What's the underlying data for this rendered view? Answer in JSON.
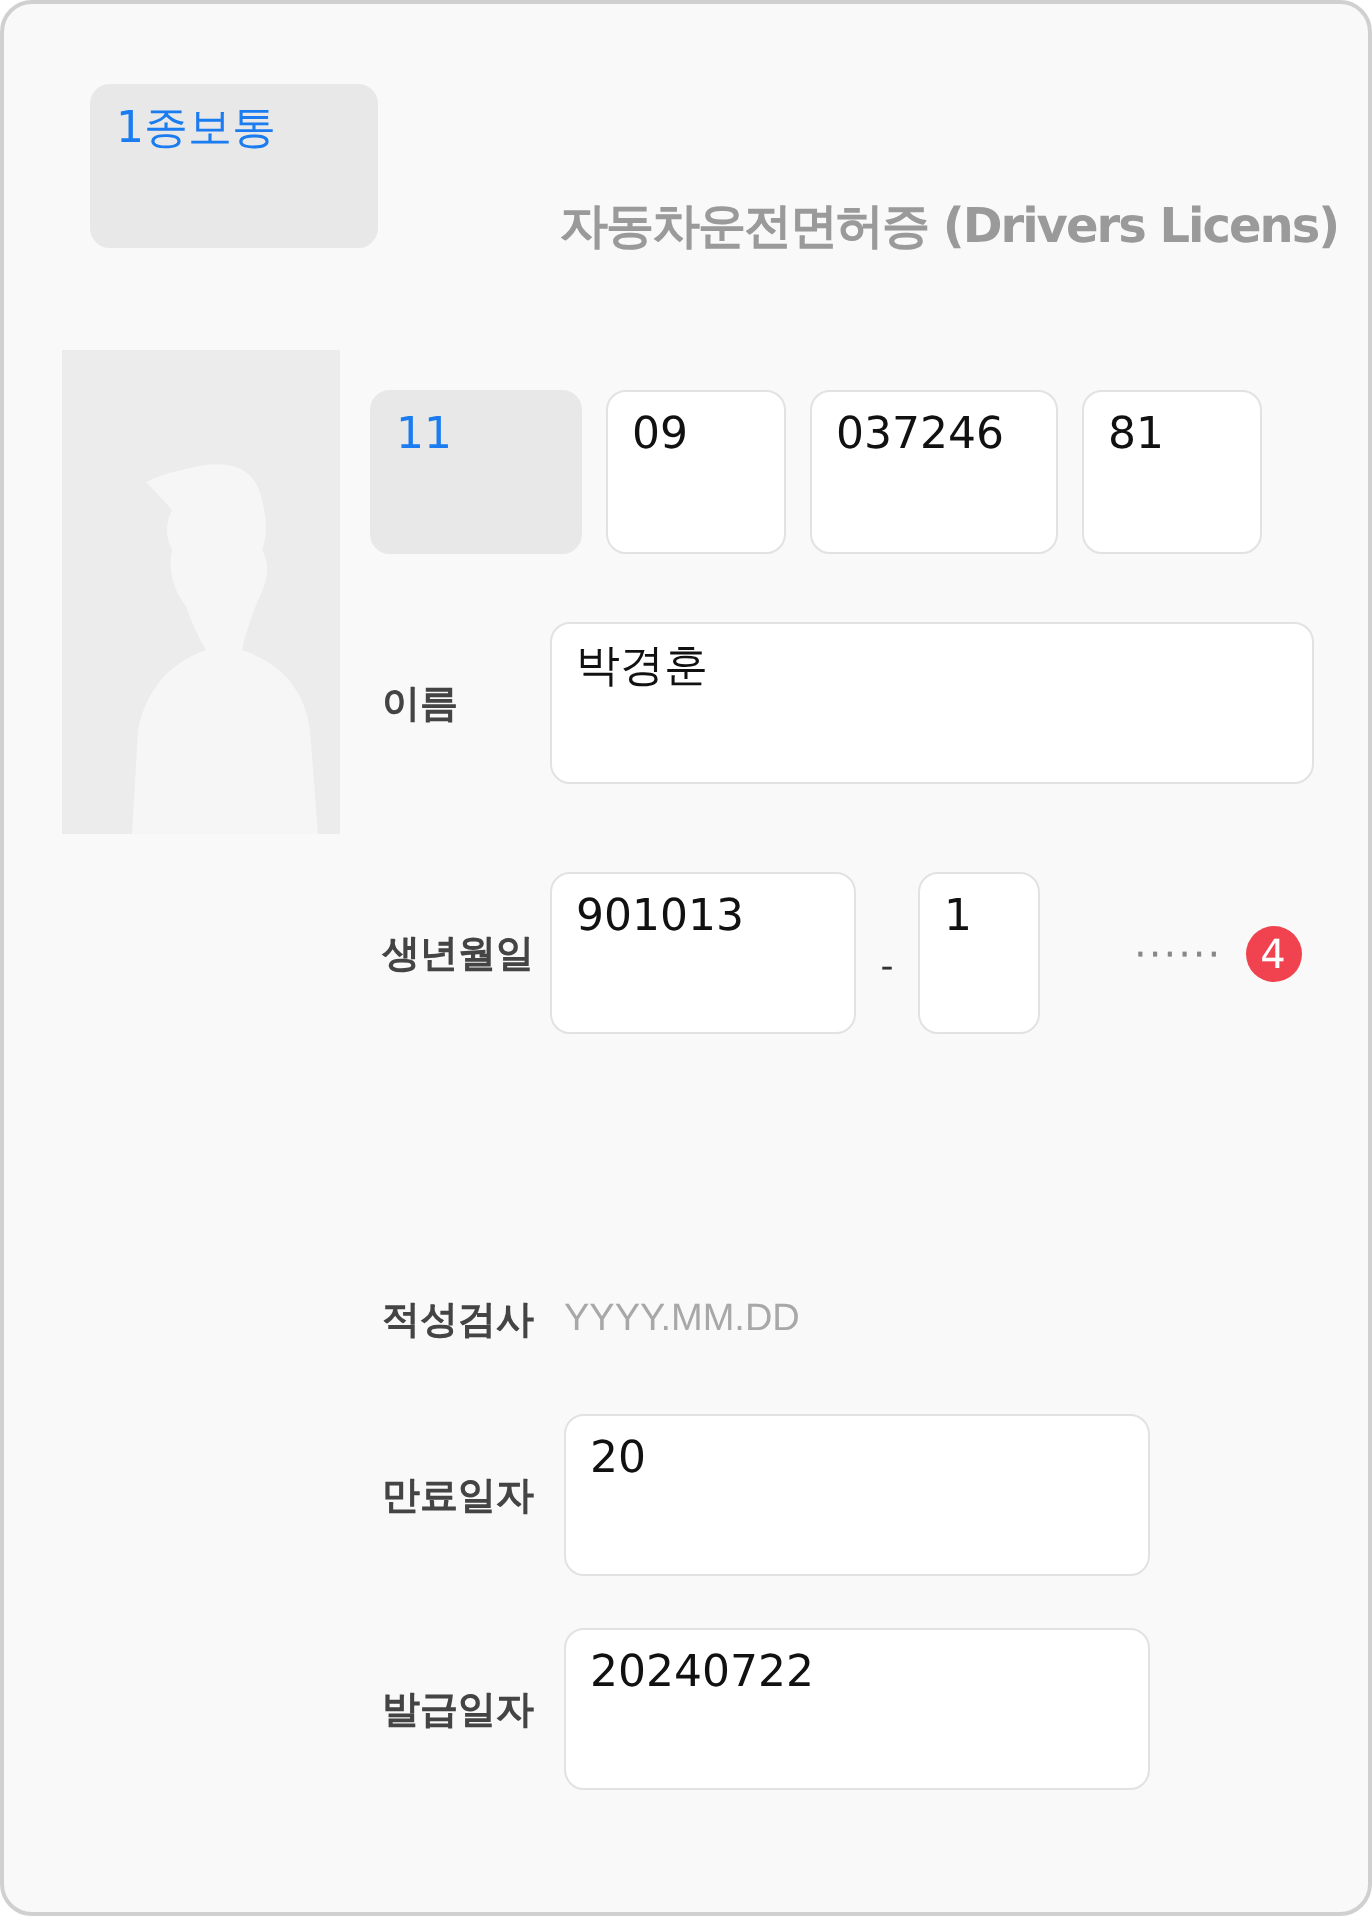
{
  "license_type": {
    "value": "1종보통",
    "disabled": true
  },
  "title": "자동차운전면허증 (Drivers Licens)",
  "license_number": [
    {
      "value": "11",
      "disabled": true
    },
    {
      "value": "09",
      "disabled": false
    },
    {
      "value": "037246",
      "disabled": false
    },
    {
      "value": "81",
      "disabled": false
    }
  ],
  "name": {
    "label": "이름",
    "value": "박경훈"
  },
  "birth": {
    "label": "생년월일",
    "value": "901013",
    "separator": "-",
    "gender_digit": "1",
    "masked": "······"
  },
  "badge": "4",
  "aptitude_test": {
    "label": "적성검사",
    "placeholder": "YYYY.MM.DD"
  },
  "expiry": {
    "label": "만료일자",
    "value": "20"
  },
  "issue": {
    "label": "발급일자",
    "value": "20240722"
  }
}
